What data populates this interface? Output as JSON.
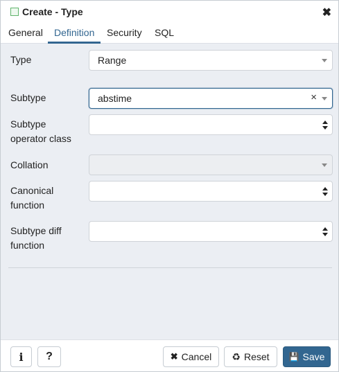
{
  "dialog": {
    "title": "Create - Type",
    "close_glyph": "✖"
  },
  "tabs": [
    {
      "label": "General"
    },
    {
      "label": "Definition"
    },
    {
      "label": "Security"
    },
    {
      "label": "SQL"
    }
  ],
  "active_tab": "Definition",
  "fields": {
    "type": {
      "label": "Type",
      "value": "Range"
    },
    "subtype": {
      "label": "Subtype",
      "value": "abstime",
      "clear_glyph": "×"
    },
    "subtype_opclass": {
      "label_line1": "Subtype",
      "label_line2": "operator class",
      "value": ""
    },
    "collation": {
      "label": "Collation",
      "value": ""
    },
    "canonical": {
      "label_line1": "Canonical",
      "label_line2": "function",
      "value": ""
    },
    "subtype_diff": {
      "label_line1": "Subtype diff",
      "label_line2": "function",
      "value": ""
    }
  },
  "footer": {
    "info_glyph": "i",
    "help_glyph": "?",
    "cancel_icon": "✖",
    "cancel_label": "Cancel",
    "reset_icon": "♻",
    "reset_label": "Reset",
    "save_icon": "💾",
    "save_label": "Save"
  },
  "colors": {
    "accent": "#326690",
    "content_bg": "#ebeef3"
  }
}
